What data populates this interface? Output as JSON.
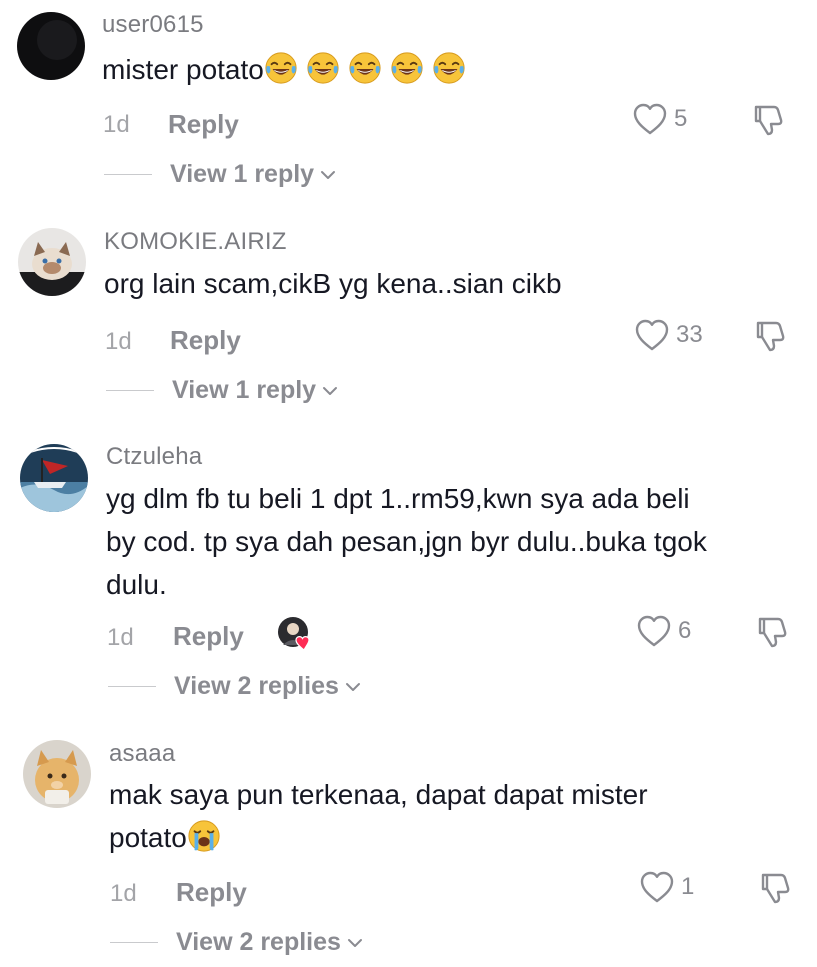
{
  "comments": [
    {
      "username": "user0615",
      "text": "mister potato",
      "emojis": [
        "face-with-tears-of-joy-icon",
        "face-with-tears-of-joy-icon",
        "face-with-tears-of-joy-icon",
        "face-with-tears-of-joy-icon",
        "face-with-tears-of-joy-icon"
      ],
      "time": "1d",
      "reply_label": "Reply",
      "likes": "5",
      "view_replies": "View 1 reply"
    },
    {
      "username": "KOMOKIE.AIRIZ",
      "text": "org lain scam,cikB yg kena..sian cikb",
      "time": "1d",
      "reply_label": "Reply",
      "likes": "33",
      "view_replies": "View 1 reply"
    },
    {
      "username": "Ctzuleha",
      "text_lines": [
        "yg dlm fb tu beli 1 dpt 1..rm59,kwn sya ada beli",
        "by cod. tp sya dah pesan,jgn byr dulu..buka tgok",
        "dulu."
      ],
      "time": "1d",
      "reply_label": "Reply",
      "likes": "6",
      "liked_by_creator": true,
      "view_replies": "View 2 replies"
    },
    {
      "username": "asaaa",
      "text_lines": [
        "mak saya pun terkenaa, dapat dapat mister",
        "potato"
      ],
      "emojis": [
        "loudly-crying-face-icon"
      ],
      "time": "1d",
      "reply_label": "Reply",
      "likes": "1",
      "view_replies": "View 2 replies"
    }
  ],
  "colors": {
    "text": "#161823",
    "muted": "#8a8b91",
    "username": "#7a7b80",
    "creator_heart": "#fe2c55"
  }
}
